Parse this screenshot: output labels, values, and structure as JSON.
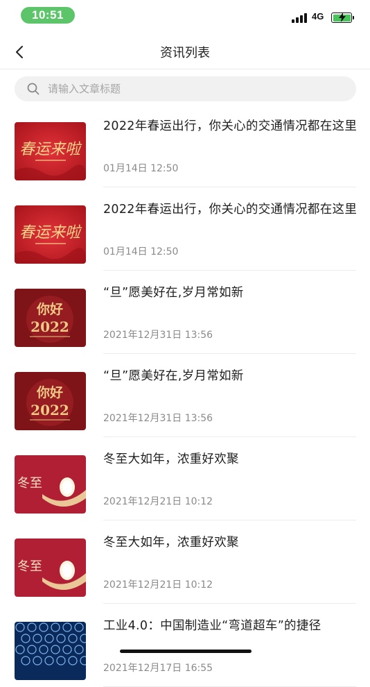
{
  "status_bar": {
    "time": "10:51",
    "network": "4G",
    "icons": [
      "signal-icon",
      "battery-charging-icon"
    ],
    "time_pill_color": "#5cc56a"
  },
  "nav": {
    "title": "资讯列表",
    "back_icon": "chevron-left-icon"
  },
  "search": {
    "placeholder": "请输入文章标题",
    "value": "",
    "icon": "search-icon"
  },
  "articles": [
    {
      "title": "2022年春运出行，你关心的交通情况都在这里",
      "date": "01月14日 12:50",
      "thumb": "spring-festival-travel",
      "thumb_text": "春运来啦"
    },
    {
      "title": "2022年春运出行，你关心的交通情况都在这里",
      "date": "01月14日 12:50",
      "thumb": "spring-festival-travel",
      "thumb_text": "春运来啦"
    },
    {
      "title": "“旦”愿美好在,岁月常如新",
      "date": "2021年12月31日 13:56",
      "thumb": "hello-2022",
      "thumb_text": "你好2022"
    },
    {
      "title": "“旦”愿美好在,岁月常如新",
      "date": "2021年12月31日 13:56",
      "thumb": "hello-2022",
      "thumb_text": "你好2022"
    },
    {
      "title": "冬至大如年，浓重好欢聚",
      "date": "2021年12月21日 10:12",
      "thumb": "winter-solstice",
      "thumb_text": "冬至"
    },
    {
      "title": "冬至大如年，浓重好欢聚",
      "date": "2021年12月21日 10:12",
      "thumb": "winter-solstice",
      "thumb_text": "冬至"
    },
    {
      "title": "工业4.0：中国制造业“弯道超车”的捷径",
      "date": "2021年12月17日 16:55",
      "thumb": "industry-4",
      "thumb_text": ""
    }
  ],
  "colors": {
    "accent_red": "#c8232a",
    "dark_red": "#8e1a1f",
    "date_gray": "#8a8a8a",
    "search_bg": "#f1f1f1"
  }
}
